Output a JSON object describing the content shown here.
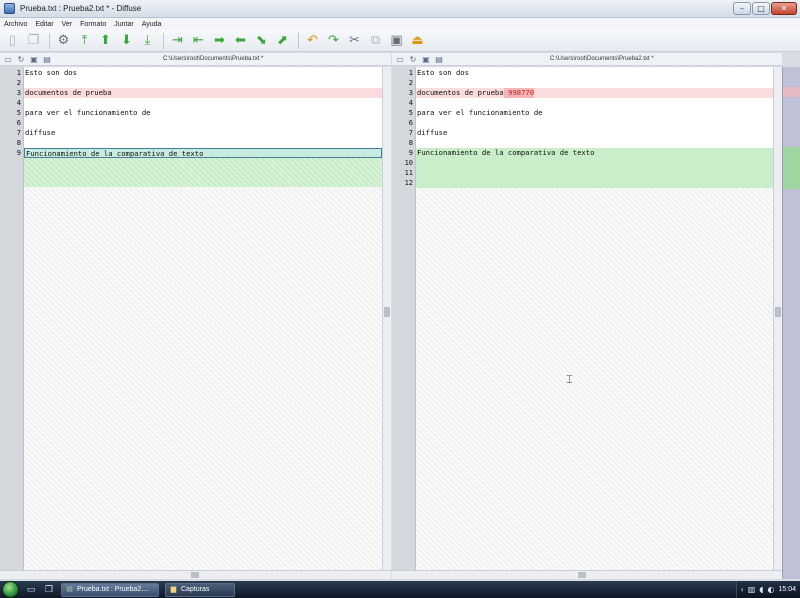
{
  "window": {
    "title": "Prueba.txt : Prueba2.txt * - Diffuse",
    "btn_minimize": "–",
    "btn_maximize": "□",
    "btn_close": "✕"
  },
  "menu": [
    "Archivo",
    "Editar",
    "Ver",
    "Formato",
    "Juntar",
    "Ayuda"
  ],
  "left_pane": {
    "path": "C:\\Users\\root\\Documents\\Prueba.txt *",
    "lines": [
      {
        "n": "1",
        "text": "Esto son dos",
        "style": "white"
      },
      {
        "n": "2",
        "text": "",
        "style": "white"
      },
      {
        "n": "3",
        "text": "documentos de prueba",
        "style": "red"
      },
      {
        "n": "4",
        "text": "",
        "style": "white"
      },
      {
        "n": "5",
        "text": "para ver el funcionamiento de",
        "style": "white"
      },
      {
        "n": "6",
        "text": "",
        "style": "white"
      },
      {
        "n": "7",
        "text": "diffuse",
        "style": "white"
      },
      {
        "n": "8",
        "text": "",
        "style": "white"
      },
      {
        "n": "9",
        "text": "Funcionamiento de la comparativa de texto",
        "style": "cursor"
      }
    ]
  },
  "right_pane": {
    "path": "C:\\Users\\root\\Documents\\Prueba2.txt *",
    "lines": [
      {
        "n": "1",
        "text": "Esto son dos",
        "style": "white"
      },
      {
        "n": "2",
        "text": "",
        "style": "white"
      },
      {
        "n": "3",
        "text": "documentos de prueba",
        "hl": " 998770",
        "style": "red"
      },
      {
        "n": "4",
        "text": "",
        "style": "white"
      },
      {
        "n": "5",
        "text": "para ver el funcionamiento de",
        "style": "white"
      },
      {
        "n": "6",
        "text": "",
        "style": "white"
      },
      {
        "n": "7",
        "text": "diffuse",
        "style": "white"
      },
      {
        "n": "8",
        "text": "",
        "style": "white"
      },
      {
        "n": "9",
        "text": "Funcionamiento de la comparativa de texto",
        "style": "green"
      },
      {
        "n": "10",
        "text": "",
        "style": "green"
      },
      {
        "n": "11",
        "text": "",
        "style": "green"
      },
      {
        "n": "12",
        "text": "",
        "style": "green"
      }
    ]
  },
  "toolbar_icons": [
    {
      "name": "new-file-icon",
      "glyph": "▯",
      "color": "gray"
    },
    {
      "name": "copy-file-icon",
      "glyph": "❐",
      "color": "gray"
    },
    {
      "sep": true
    },
    {
      "name": "realign-icon",
      "glyph": "⚙",
      "color": "dark"
    },
    {
      "name": "first-difference-icon",
      "glyph": "⤒",
      "color": "green"
    },
    {
      "name": "previous-difference-icon",
      "glyph": "⬆",
      "color": "green"
    },
    {
      "name": "next-difference-icon",
      "glyph": "⬇",
      "color": "green"
    },
    {
      "name": "last-difference-icon",
      "glyph": "⤓",
      "color": "green"
    },
    {
      "sep": true
    },
    {
      "name": "copy-left-all-icon",
      "glyph": "⇥",
      "color": "green"
    },
    {
      "name": "copy-right-all-icon",
      "glyph": "⇤",
      "color": "green"
    },
    {
      "name": "copy-left-icon",
      "glyph": "➡",
      "color": "green"
    },
    {
      "name": "copy-right-icon",
      "glyph": "⬅",
      "color": "green"
    },
    {
      "name": "merge-left-icon",
      "glyph": "⬊",
      "color": "green"
    },
    {
      "name": "merge-right-icon",
      "glyph": "⬈",
      "color": "green"
    },
    {
      "sep": true
    },
    {
      "name": "undo-icon",
      "glyph": "↶",
      "color": "orange"
    },
    {
      "name": "redo-icon",
      "glyph": "↷",
      "color": "green"
    },
    {
      "name": "cut-icon",
      "glyph": "✂",
      "color": "dark"
    },
    {
      "name": "copy-icon",
      "glyph": "⧉",
      "color": "gray"
    },
    {
      "name": "paste-icon",
      "glyph": "▣",
      "color": "dark"
    },
    {
      "name": "clear-edits-icon",
      "glyph": "⏏",
      "color": "orange"
    }
  ],
  "taskbar": {
    "tasks": [
      {
        "label": "Prueba.txt : Prueba2....",
        "icon": "diffuse-icon",
        "glyph": "▤",
        "active": true
      },
      {
        "label": "Capturas",
        "icon": "folder-icon",
        "glyph": "▆",
        "active": false
      }
    ],
    "clock": "15:04"
  }
}
